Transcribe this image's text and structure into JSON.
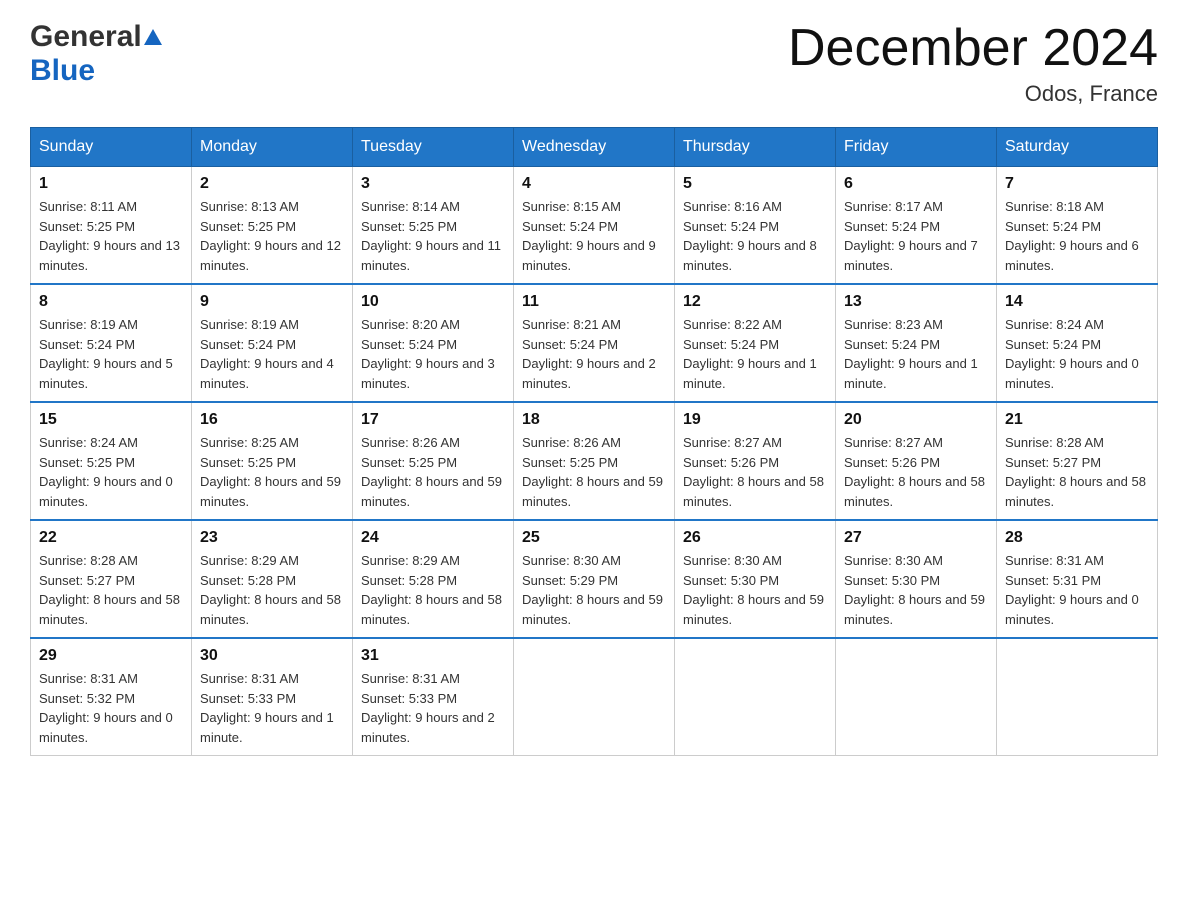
{
  "header": {
    "logo_general": "General",
    "logo_blue": "Blue",
    "title": "December 2024",
    "location": "Odos, France"
  },
  "days_of_week": [
    "Sunday",
    "Monday",
    "Tuesday",
    "Wednesday",
    "Thursday",
    "Friday",
    "Saturday"
  ],
  "weeks": [
    [
      {
        "day": "1",
        "sunrise": "Sunrise: 8:11 AM",
        "sunset": "Sunset: 5:25 PM",
        "daylight": "Daylight: 9 hours and 13 minutes."
      },
      {
        "day": "2",
        "sunrise": "Sunrise: 8:13 AM",
        "sunset": "Sunset: 5:25 PM",
        "daylight": "Daylight: 9 hours and 12 minutes."
      },
      {
        "day": "3",
        "sunrise": "Sunrise: 8:14 AM",
        "sunset": "Sunset: 5:25 PM",
        "daylight": "Daylight: 9 hours and 11 minutes."
      },
      {
        "day": "4",
        "sunrise": "Sunrise: 8:15 AM",
        "sunset": "Sunset: 5:24 PM",
        "daylight": "Daylight: 9 hours and 9 minutes."
      },
      {
        "day": "5",
        "sunrise": "Sunrise: 8:16 AM",
        "sunset": "Sunset: 5:24 PM",
        "daylight": "Daylight: 9 hours and 8 minutes."
      },
      {
        "day": "6",
        "sunrise": "Sunrise: 8:17 AM",
        "sunset": "Sunset: 5:24 PM",
        "daylight": "Daylight: 9 hours and 7 minutes."
      },
      {
        "day": "7",
        "sunrise": "Sunrise: 8:18 AM",
        "sunset": "Sunset: 5:24 PM",
        "daylight": "Daylight: 9 hours and 6 minutes."
      }
    ],
    [
      {
        "day": "8",
        "sunrise": "Sunrise: 8:19 AM",
        "sunset": "Sunset: 5:24 PM",
        "daylight": "Daylight: 9 hours and 5 minutes."
      },
      {
        "day": "9",
        "sunrise": "Sunrise: 8:19 AM",
        "sunset": "Sunset: 5:24 PM",
        "daylight": "Daylight: 9 hours and 4 minutes."
      },
      {
        "day": "10",
        "sunrise": "Sunrise: 8:20 AM",
        "sunset": "Sunset: 5:24 PM",
        "daylight": "Daylight: 9 hours and 3 minutes."
      },
      {
        "day": "11",
        "sunrise": "Sunrise: 8:21 AM",
        "sunset": "Sunset: 5:24 PM",
        "daylight": "Daylight: 9 hours and 2 minutes."
      },
      {
        "day": "12",
        "sunrise": "Sunrise: 8:22 AM",
        "sunset": "Sunset: 5:24 PM",
        "daylight": "Daylight: 9 hours and 1 minute."
      },
      {
        "day": "13",
        "sunrise": "Sunrise: 8:23 AM",
        "sunset": "Sunset: 5:24 PM",
        "daylight": "Daylight: 9 hours and 1 minute."
      },
      {
        "day": "14",
        "sunrise": "Sunrise: 8:24 AM",
        "sunset": "Sunset: 5:24 PM",
        "daylight": "Daylight: 9 hours and 0 minutes."
      }
    ],
    [
      {
        "day": "15",
        "sunrise": "Sunrise: 8:24 AM",
        "sunset": "Sunset: 5:25 PM",
        "daylight": "Daylight: 9 hours and 0 minutes."
      },
      {
        "day": "16",
        "sunrise": "Sunrise: 8:25 AM",
        "sunset": "Sunset: 5:25 PM",
        "daylight": "Daylight: 8 hours and 59 minutes."
      },
      {
        "day": "17",
        "sunrise": "Sunrise: 8:26 AM",
        "sunset": "Sunset: 5:25 PM",
        "daylight": "Daylight: 8 hours and 59 minutes."
      },
      {
        "day": "18",
        "sunrise": "Sunrise: 8:26 AM",
        "sunset": "Sunset: 5:25 PM",
        "daylight": "Daylight: 8 hours and 59 minutes."
      },
      {
        "day": "19",
        "sunrise": "Sunrise: 8:27 AM",
        "sunset": "Sunset: 5:26 PM",
        "daylight": "Daylight: 8 hours and 58 minutes."
      },
      {
        "day": "20",
        "sunrise": "Sunrise: 8:27 AM",
        "sunset": "Sunset: 5:26 PM",
        "daylight": "Daylight: 8 hours and 58 minutes."
      },
      {
        "day": "21",
        "sunrise": "Sunrise: 8:28 AM",
        "sunset": "Sunset: 5:27 PM",
        "daylight": "Daylight: 8 hours and 58 minutes."
      }
    ],
    [
      {
        "day": "22",
        "sunrise": "Sunrise: 8:28 AM",
        "sunset": "Sunset: 5:27 PM",
        "daylight": "Daylight: 8 hours and 58 minutes."
      },
      {
        "day": "23",
        "sunrise": "Sunrise: 8:29 AM",
        "sunset": "Sunset: 5:28 PM",
        "daylight": "Daylight: 8 hours and 58 minutes."
      },
      {
        "day": "24",
        "sunrise": "Sunrise: 8:29 AM",
        "sunset": "Sunset: 5:28 PM",
        "daylight": "Daylight: 8 hours and 58 minutes."
      },
      {
        "day": "25",
        "sunrise": "Sunrise: 8:30 AM",
        "sunset": "Sunset: 5:29 PM",
        "daylight": "Daylight: 8 hours and 59 minutes."
      },
      {
        "day": "26",
        "sunrise": "Sunrise: 8:30 AM",
        "sunset": "Sunset: 5:30 PM",
        "daylight": "Daylight: 8 hours and 59 minutes."
      },
      {
        "day": "27",
        "sunrise": "Sunrise: 8:30 AM",
        "sunset": "Sunset: 5:30 PM",
        "daylight": "Daylight: 8 hours and 59 minutes."
      },
      {
        "day": "28",
        "sunrise": "Sunrise: 8:31 AM",
        "sunset": "Sunset: 5:31 PM",
        "daylight": "Daylight: 9 hours and 0 minutes."
      }
    ],
    [
      {
        "day": "29",
        "sunrise": "Sunrise: 8:31 AM",
        "sunset": "Sunset: 5:32 PM",
        "daylight": "Daylight: 9 hours and 0 minutes."
      },
      {
        "day": "30",
        "sunrise": "Sunrise: 8:31 AM",
        "sunset": "Sunset: 5:33 PM",
        "daylight": "Daylight: 9 hours and 1 minute."
      },
      {
        "day": "31",
        "sunrise": "Sunrise: 8:31 AM",
        "sunset": "Sunset: 5:33 PM",
        "daylight": "Daylight: 9 hours and 2 minutes."
      },
      null,
      null,
      null,
      null
    ]
  ]
}
